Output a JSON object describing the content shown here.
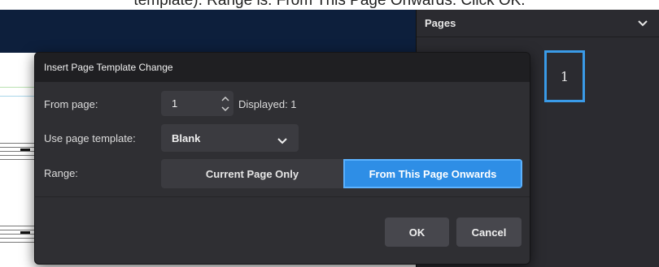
{
  "banner": {
    "text": "template). Range is: From This Page Onwards. Click OK."
  },
  "pages_panel": {
    "title": "Pages",
    "page_number": "1"
  },
  "dialog": {
    "title": "Insert Page Template Change",
    "from_page": {
      "label": "From page:",
      "value": "1",
      "displayed": "Displayed: 1"
    },
    "template": {
      "label": "Use page template:",
      "selected": "Blank"
    },
    "range": {
      "label": "Range:",
      "options": [
        "Current Page Only",
        "From This Page Onwards"
      ],
      "selected": "From This Page Onwards"
    },
    "buttons": {
      "ok": "OK",
      "cancel": "Cancel"
    }
  },
  "colors": {
    "accent": "#2e8ee6",
    "selection_border": "#3a9be8",
    "dialog_bg": "#2f2f33"
  }
}
